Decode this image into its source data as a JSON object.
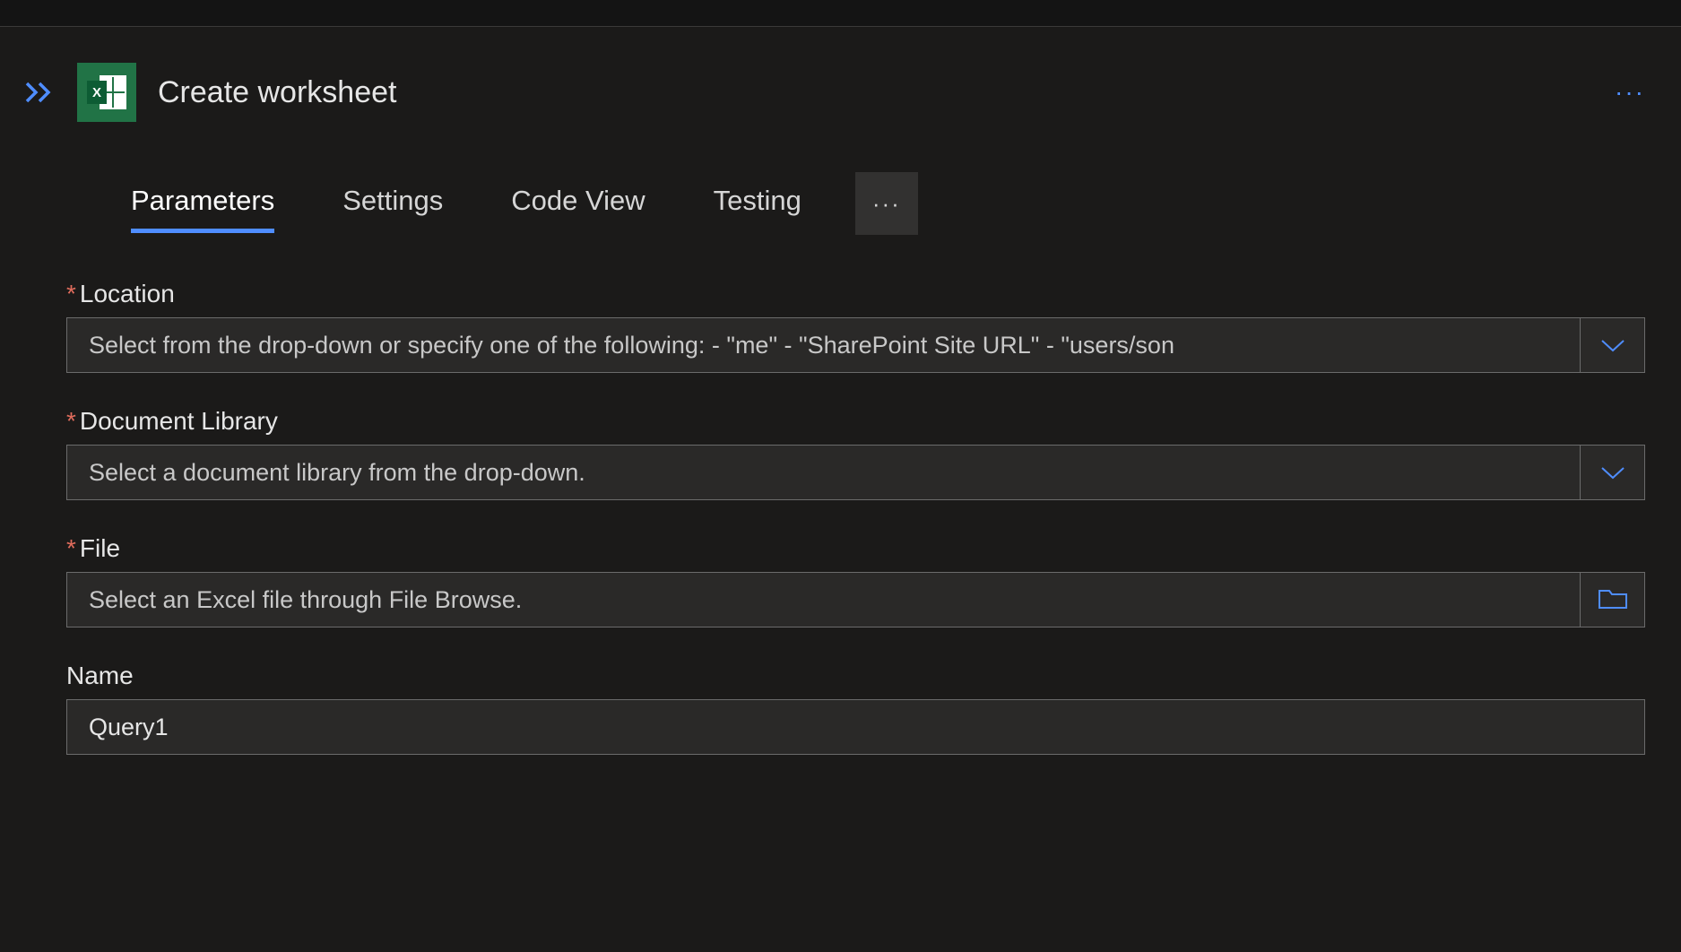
{
  "header": {
    "title": "Create worksheet"
  },
  "tabs": {
    "parameters": "Parameters",
    "settings": "Settings",
    "codeview": "Code View",
    "testing": "Testing"
  },
  "fields": {
    "location": {
      "label": "Location",
      "placeholder": "Select from the drop-down or specify one of the following: - \"me\" - \"SharePoint Site URL\" - \"users/son"
    },
    "documentLibrary": {
      "label": "Document Library",
      "placeholder": "Select a document library from the drop-down."
    },
    "file": {
      "label": "File",
      "placeholder": "Select an Excel file through File Browse."
    },
    "name": {
      "label": "Name",
      "value": "Query1"
    }
  }
}
